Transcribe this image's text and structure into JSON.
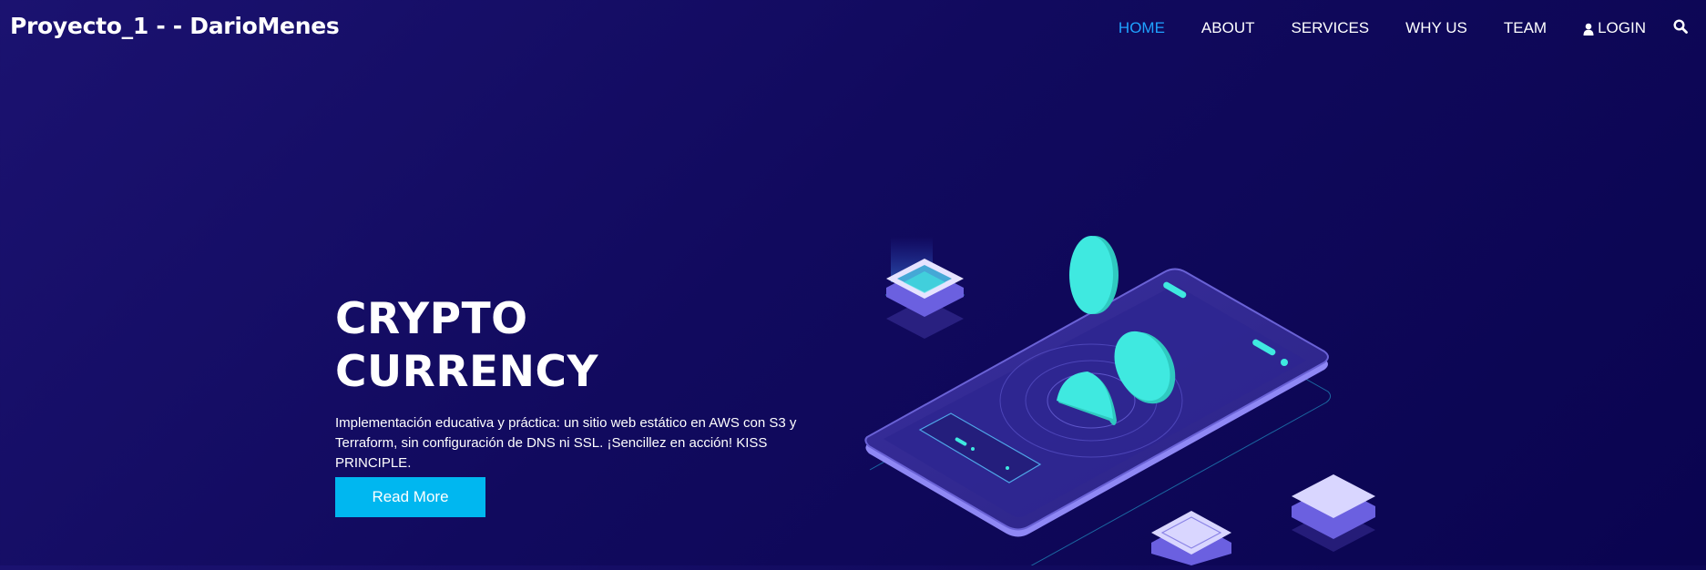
{
  "header": {
    "brand": "Proyecto_1 - - DarioMenes",
    "nav": [
      {
        "label": "HOME",
        "active": true
      },
      {
        "label": "ABOUT",
        "active": false
      },
      {
        "label": "SERVICES",
        "active": false
      },
      {
        "label": "WHY US",
        "active": false
      },
      {
        "label": "TEAM",
        "active": false
      },
      {
        "label": "LOGIN",
        "active": false,
        "icon": "user-icon"
      }
    ],
    "search_icon": "search-icon"
  },
  "hero": {
    "title_line1": "CRYPTO",
    "title_line2": "CURRENCY",
    "description": "Implementación educativa y práctica: un sitio web estático en AWS con S3 y Terraform, sin configuración de DNS ni SSL. ¡Sencillez en acción! KISS PRINCIPLE.",
    "button_label": "Read More"
  },
  "colors": {
    "background_start": "#1b1270",
    "background_end": "#0a0450",
    "nav_active": "#1fa2ff",
    "button": "#00b7f0",
    "coin": "#3fe9e0",
    "phone": "#2d2690",
    "phone_edge": "#8f88f5"
  }
}
